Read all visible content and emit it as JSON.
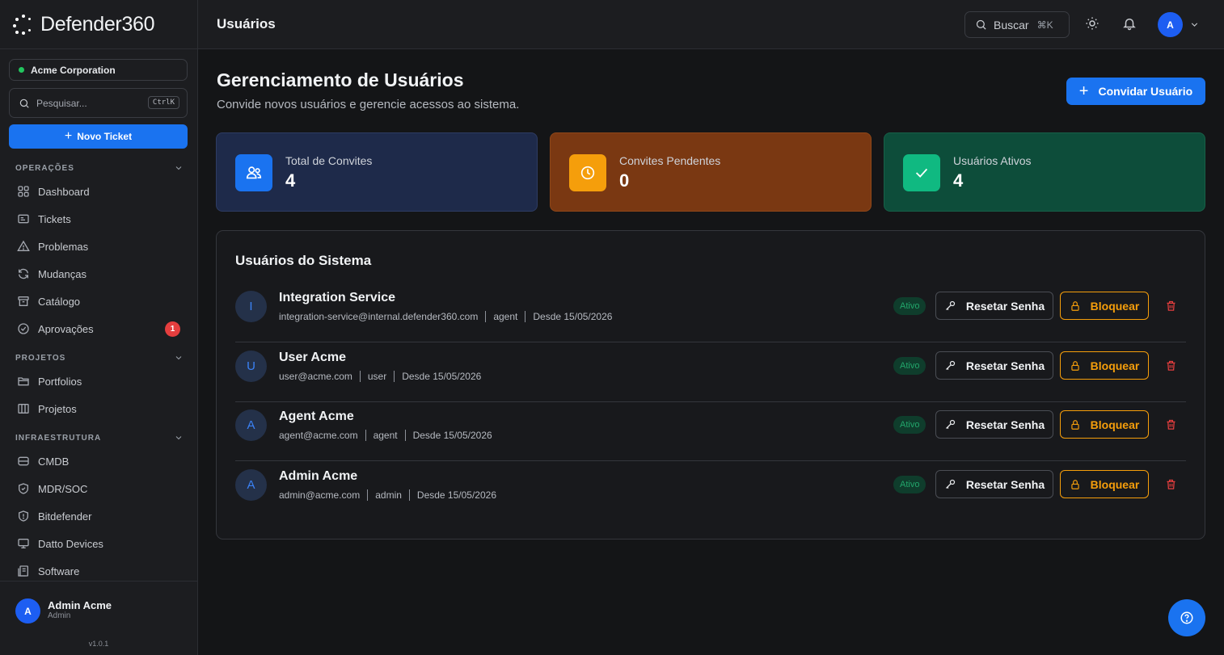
{
  "brand": {
    "name": "Defender360"
  },
  "org": {
    "name": "Acme Corporation"
  },
  "sidebar_search": {
    "placeholder": "Pesquisar...",
    "shortcut": "CtrlK"
  },
  "new_ticket": {
    "label": "Novo Ticket"
  },
  "sections": {
    "operacoes": "OPERAÇÕES",
    "projetos": "PROJETOS",
    "infra": "INFRAESTRUTURA"
  },
  "nav": {
    "dashboard": "Dashboard",
    "tickets": "Tickets",
    "problemas": "Problemas",
    "mudancas": "Mudanças",
    "catalogo": "Catálogo",
    "aprovacoes": "Aprovações",
    "aprovacoes_badge": "1",
    "portfolios": "Portfolios",
    "projetos": "Projetos",
    "cmdb": "CMDB",
    "mdr": "MDR/SOC",
    "bitdefender": "Bitdefender",
    "datto": "Datto Devices",
    "software": "Software"
  },
  "current_user": {
    "initial": "A",
    "name": "Admin Acme",
    "role": "Admin"
  },
  "version": "v1.0.1",
  "topbar": {
    "title": "Usuários",
    "search_label": "Buscar",
    "search_shortcut": "⌘K",
    "avatar_initial": "A"
  },
  "page": {
    "title": "Gerenciamento de Usuários",
    "subtitle": "Convide novos usuários e gerencie acessos ao sistema.",
    "invite_label": "Convidar Usuário"
  },
  "stats": [
    {
      "label": "Total de Convites",
      "value": "4",
      "color": "#1e2a4a"
    },
    {
      "label": "Convites Pendentes",
      "value": "0",
      "color": "#7a3812"
    },
    {
      "label": "Usuários Ativos",
      "value": "4",
      "color": "#0d4d3a"
    }
  ],
  "users_panel": {
    "title": "Usuários do Sistema",
    "status_label": "Ativo",
    "reset_label": "Resetar Senha",
    "block_label": "Bloquear",
    "users": [
      {
        "initial": "I",
        "name": "Integration Service",
        "email": "integration-service@internal.defender360.com",
        "role": "agent",
        "since": "Desde 15/05/2026"
      },
      {
        "initial": "U",
        "name": "User Acme",
        "email": "user@acme.com",
        "role": "user",
        "since": "Desde 15/05/2026"
      },
      {
        "initial": "A",
        "name": "Agent Acme",
        "email": "agent@acme.com",
        "role": "agent",
        "since": "Desde 15/05/2026"
      },
      {
        "initial": "A",
        "name": "Admin Acme",
        "email": "admin@acme.com",
        "role": "admin",
        "since": "Desde 15/05/2026"
      }
    ]
  },
  "colors": {
    "accent": "#1a73f0",
    "warning": "#f59e0b",
    "success": "#22a66b",
    "danger": "#e53e3e"
  }
}
